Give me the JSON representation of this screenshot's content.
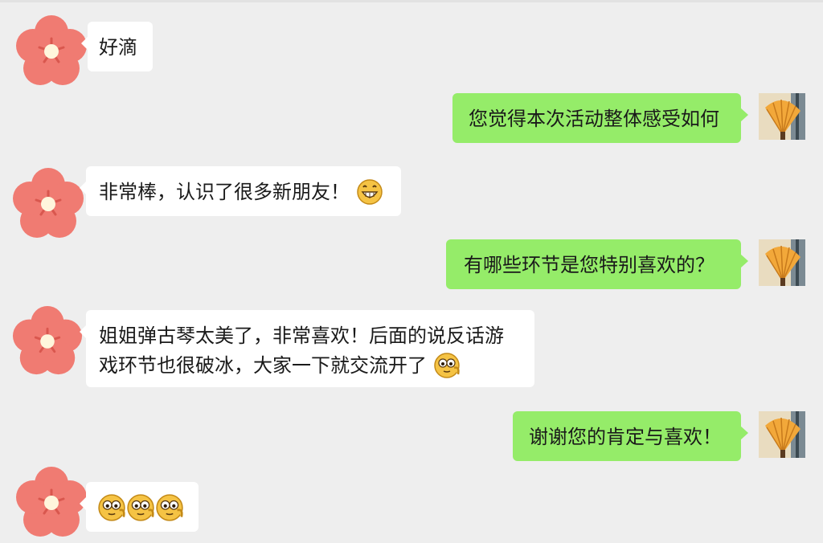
{
  "chat": {
    "messages": [
      {
        "side": "left",
        "text": "好滴"
      },
      {
        "side": "right",
        "text": "您觉得本次活动整体感受如何"
      },
      {
        "side": "left",
        "text": "非常棒，认识了很多新朋友！",
        "emoji": "grin-emoji"
      },
      {
        "side": "right",
        "text": "有哪些环节是您特别喜欢的？"
      },
      {
        "side": "left",
        "text_line1": "姐姐弹古琴太美了，非常喜欢！后面的说反话游",
        "text_line2": "戏环节也很破冰，大家一下就交流开了",
        "emoji": "wow-emoji"
      },
      {
        "side": "right",
        "text": "谢谢您的肯定与喜欢！"
      },
      {
        "side": "left",
        "text": "",
        "emojis": [
          "wow-emoji",
          "wow-emoji",
          "wow-emoji"
        ]
      }
    ]
  },
  "avatars": {
    "left": "flower-avatar",
    "right": "fan-photo-avatar"
  },
  "colors": {
    "background": "#eeeeee",
    "bubble_left": "#ffffff",
    "bubble_right": "#95ec69",
    "flower": "#f07b72"
  }
}
